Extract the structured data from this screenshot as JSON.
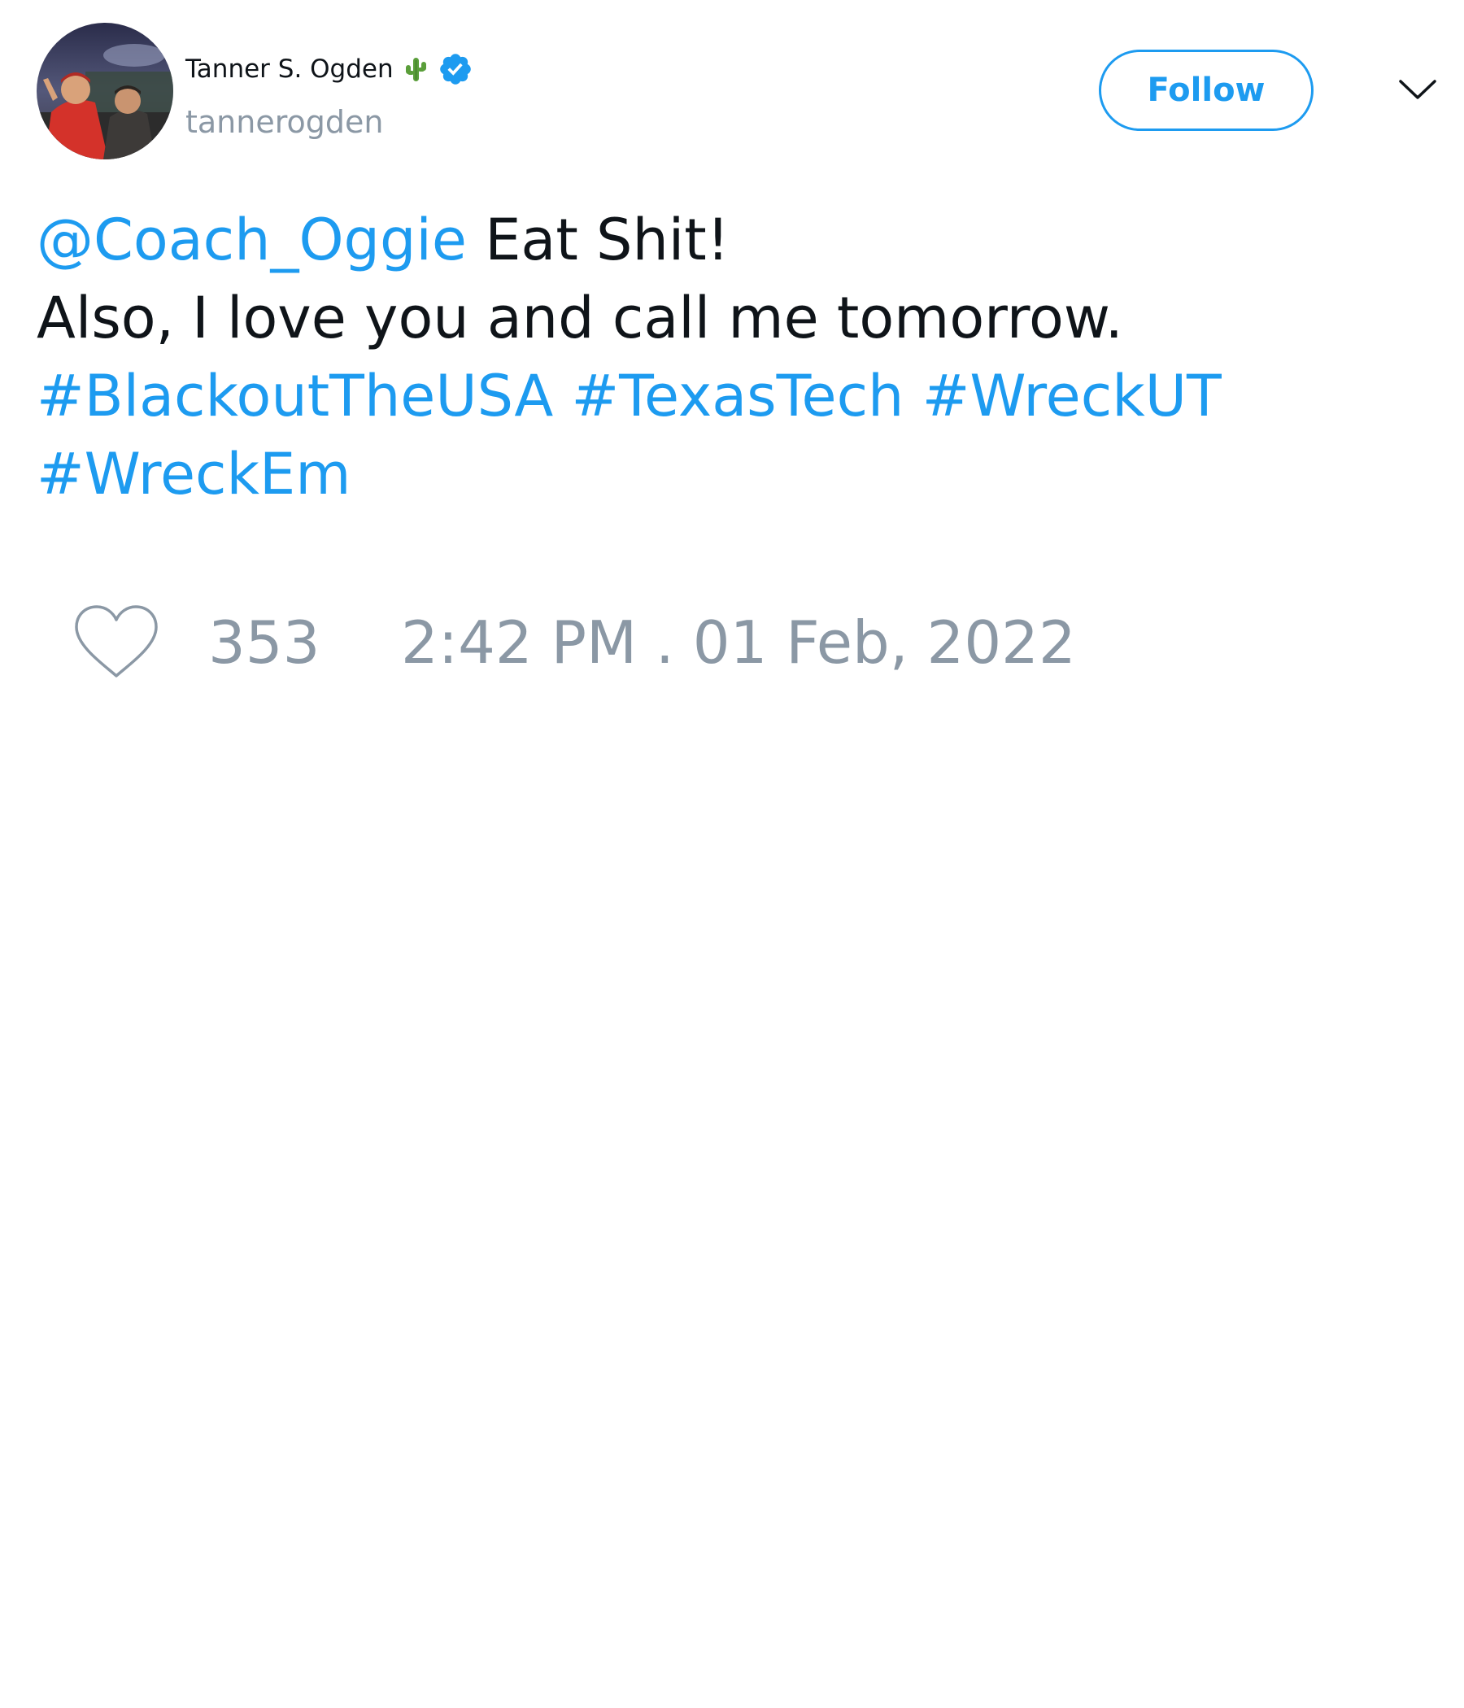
{
  "author": {
    "display_name": "Tanner S. Ogden",
    "handle": "tannerogden",
    "name_emoji": "cactus-icon",
    "verified_icon": "verified-badge-icon",
    "avatar": "profile-photo"
  },
  "header": {
    "follow_label": "Follow",
    "menu_icon": "chevron-down-icon"
  },
  "tweet": {
    "mention": "@Coach_Oggie",
    "text_1": " Eat Shit!",
    "text_2": "Also, I love you and call me tomorrow.",
    "hashtags": [
      "#BlackoutTheUSA",
      "#TexasTech",
      "#WreckUT",
      "#WreckEm"
    ]
  },
  "actions": {
    "like_icon": "heart-icon",
    "like_count": "353",
    "timestamp": "2:42 PM . 01 Feb, 2022"
  },
  "colors": {
    "accent": "#1d9bf0",
    "muted": "#8b98a5",
    "text": "#0f1419"
  }
}
